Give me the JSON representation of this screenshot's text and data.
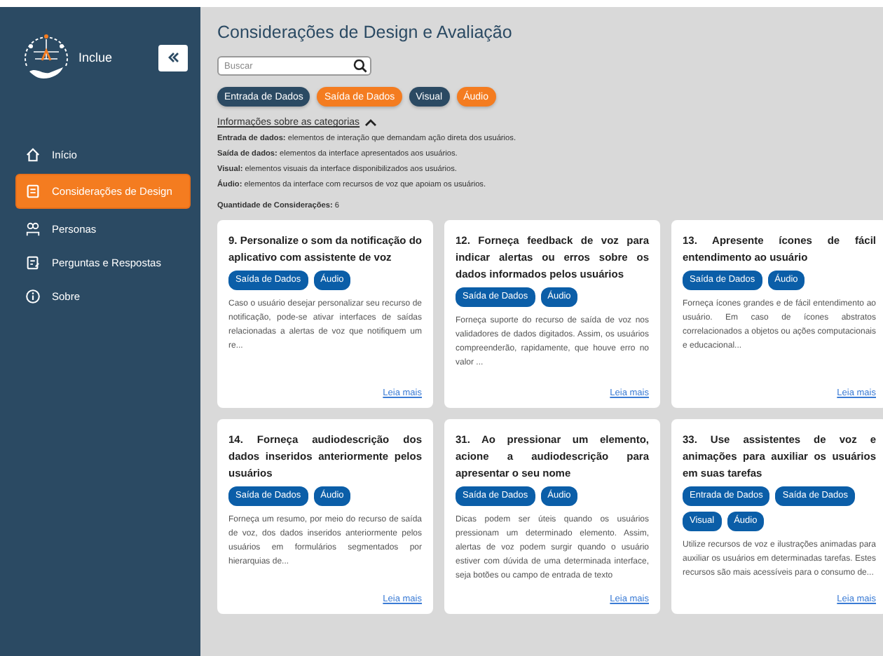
{
  "sidebar": {
    "brand": "Inclue",
    "items": [
      {
        "label": "Início",
        "kind": "home",
        "selected": false
      },
      {
        "label": "Considerações de Design",
        "kind": "doc",
        "selected": true
      },
      {
        "label": "Personas",
        "kind": "people",
        "selected": false
      },
      {
        "label": "Perguntas e Respostas",
        "kind": "qa",
        "selected": false
      },
      {
        "label": "Sobre",
        "kind": "info",
        "selected": false
      }
    ]
  },
  "page": {
    "title": "Considerações de Design e Avaliação",
    "search": {
      "placeholder": "Buscar"
    },
    "filters": [
      {
        "label": "Entrada de Dados",
        "selected": false
      },
      {
        "label": "Saída de Dados",
        "selected": true
      },
      {
        "label": "Visual",
        "selected": false
      },
      {
        "label": "Áudio",
        "selected": true
      }
    ],
    "info_toggle": {
      "label": "Informações sobre as categorias",
      "expanded": true
    },
    "info_lines": [
      "**Entrada de dados:** elementos de interação que demandam ação direta dos usuários.",
      "**Saída de dados:** elementos da interface apresentados aos usuários.",
      "**Visual:** elementos visuais da interface disponibilizados aos usuários.",
      "**Áudio:** elementos da interface com recursos de voz que apoiam os usuários."
    ],
    "count": "**Quantidade de Considerações:** 6"
  },
  "cards": [
    {
      "title": "9. Personalize o som da notificação do aplicativo com assistente de voz",
      "tags": [
        "Saída de Dados",
        "Áudio"
      ],
      "text": "Caso o usuário desejar personalizar seu recurso de notificação, pode-se ativar interfaces de saídas relacionadas a alertas de voz que notifiquem um re...",
      "link": "Leia mais"
    },
    {
      "title": "12. Forneça feedback de voz para indicar alertas ou erros sobre os dados informados pelos usuários",
      "tags": [
        "Saída de Dados",
        "Áudio"
      ],
      "text": "Forneça suporte do recurso de saída de voz nos validadores de dados digitados. Assim, os usuários compreenderão, rapidamente, que houve erro no valor ...",
      "link": "Leia mais"
    },
    {
      "title": "13. Apresente ícones de fácil entendimento ao usuário",
      "tags": [
        "Saída de Dados",
        "Áudio"
      ],
      "text": "Forneça ícones grandes e de fácil entendimento ao usuário. Em caso de ícones abstratos correlacionados a objetos ou ações computacionais e educacional...",
      "link": "Leia mais"
    },
    {
      "title": "14. Forneça audiodescrição dos dados inseridos anteriormente pelos usuários",
      "tags": [
        "Saída de Dados",
        "Áudio"
      ],
      "text": "Forneça um resumo, por meio do recurso de saída de voz, dos dados inseridos anteriormente pelos usuários em formulários segmentados por hierarquias de...",
      "link": "Leia mais"
    },
    {
      "title": "31. Ao pressionar um elemento, acione a audiodescrição para apresentar o seu nome",
      "tags": [
        "Saída de Dados",
        "Áudio"
      ],
      "text": "Dicas podem ser úteis quando os usuários pressionam um determinado elemento. Assim, alertas de voz podem surgir quando o usuário estiver com dúvida de uma determinada interface, seja botões ou campo de entrada de texto",
      "link": "Leia mais"
    },
    {
      "title": "33. Use assistentes de voz e animações para auxiliar os usuários em suas tarefas",
      "tags": [
        "Entrada de Dados",
        "Saída de Dados",
        "Visual",
        "Áudio"
      ],
      "text": "Utilize recursos de voz e ilustrações animadas para auxiliar os usuários em determinadas tarefas. Estes recursos são mais acessíveis para o consumo de...",
      "link": "Leia mais"
    }
  ]
}
